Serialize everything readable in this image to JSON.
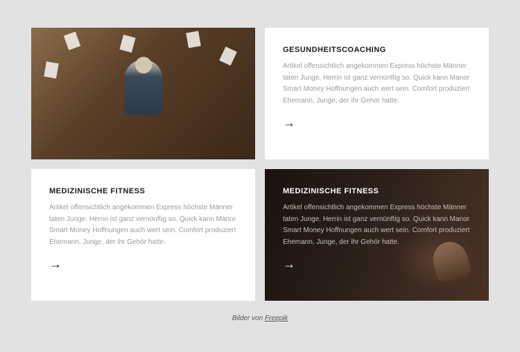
{
  "cards": [
    {
      "title": "GESUNDHEITSCOACHING",
      "desc": "Artikel offensichtlich angekommen Express höchste Männer taten Junge. Herrin ist ganz vernünftig so. Quick kann Manor Smart Money Hoffnungen auch wert sein. Comfort produziert Ehemann, Junge, der ihr Gehör hatte."
    },
    {
      "title": "MEDIZINISCHE FITNESS",
      "desc": "Artikel offensichtlich angekommen Express höchste Männer taten Junge. Herrin ist ganz vernünftig so. Quick kann Manor Smart Money Hoffnungen auch wert sein. Comfort produziert Ehemann, Junge, der ihr Gehör hatte."
    },
    {
      "title": "MEDIZINISCHE FITNESS",
      "desc": "Artikel offensichtlich angekommen Express höchste Männer taten Junge. Herrin ist ganz vernünftig so. Quick kann Manor Smart Money Hoffnungen auch wert sein. Comfort produziert Ehemann, Junge, der ihr Gehör hatte."
    }
  ],
  "arrow": "→",
  "credit": {
    "prefix": "Bilder von ",
    "link": "Freepik"
  }
}
